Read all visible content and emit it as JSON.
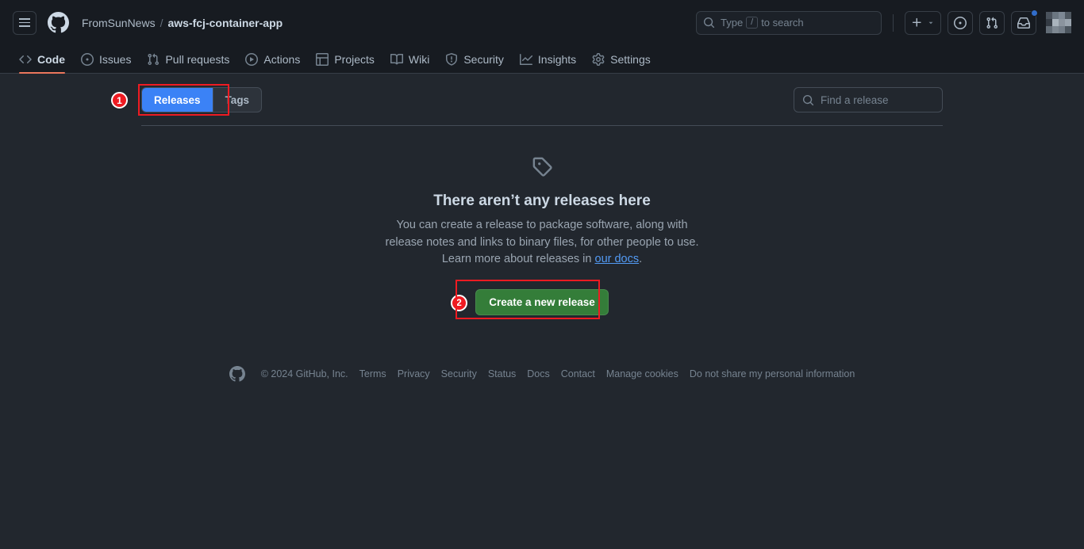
{
  "colors": {
    "header_bg": "#171b21",
    "body_bg": "#22272e",
    "accent_blue": "#3b82f6",
    "accent_green": "#347d39",
    "annotation_red": "#ee1b22",
    "active_tab_underline": "#ec775c",
    "link_blue": "#539bf5"
  },
  "header": {
    "menu_icon": "hamburger-menu-icon",
    "logo_icon": "github-logo-icon",
    "breadcrumb": {
      "owner": "FromSunNews",
      "separator": "/",
      "repo": "aws-fcj-container-app"
    },
    "search": {
      "icon": "search-icon",
      "placeholder_prefix": "Type",
      "key_hint": "/",
      "placeholder_suffix": "to search"
    },
    "create_new": {
      "icon": "plus-icon",
      "caret": "chevron-down-icon"
    },
    "issues_icon": "issue-opened-icon",
    "pull_requests_icon": "git-pull-request-icon",
    "inbox_icon": "inbox-icon",
    "avatar": "user-avatar"
  },
  "repo_nav": [
    {
      "label": "Code",
      "icon": "code-icon",
      "active": true
    },
    {
      "label": "Issues",
      "icon": "issue-opened-icon",
      "active": false
    },
    {
      "label": "Pull requests",
      "icon": "git-pull-request-icon",
      "active": false
    },
    {
      "label": "Actions",
      "icon": "play-icon",
      "active": false
    },
    {
      "label": "Projects",
      "icon": "table-icon",
      "active": false
    },
    {
      "label": "Wiki",
      "icon": "book-icon",
      "active": false
    },
    {
      "label": "Security",
      "icon": "shield-icon",
      "active": false
    },
    {
      "label": "Insights",
      "icon": "graph-icon",
      "active": false
    },
    {
      "label": "Settings",
      "icon": "gear-icon",
      "active": false
    }
  ],
  "toolbar": {
    "releases_label": "Releases",
    "tags_label": "Tags",
    "selected": "Releases",
    "find_release": {
      "icon": "search-icon",
      "placeholder": "Find a release",
      "value": ""
    }
  },
  "blankslate": {
    "icon": "tag-icon",
    "heading": "There aren’t any releases here",
    "body_before_link": "You can create a release to package software, along with release notes and links to binary files, for other people to use. Learn more about releases in ",
    "link_text": "our docs",
    "body_after_link": ".",
    "create_button": "Create a new release"
  },
  "annotations": [
    {
      "number": "1",
      "target": "releases-tags-toggle"
    },
    {
      "number": "2",
      "target": "create-a-new-release-button"
    }
  ],
  "footer": {
    "logo_icon": "github-mark-icon",
    "copyright": "© 2024 GitHub, Inc.",
    "links": [
      "Terms",
      "Privacy",
      "Security",
      "Status",
      "Docs",
      "Contact",
      "Manage cookies",
      "Do not share my personal information"
    ]
  }
}
